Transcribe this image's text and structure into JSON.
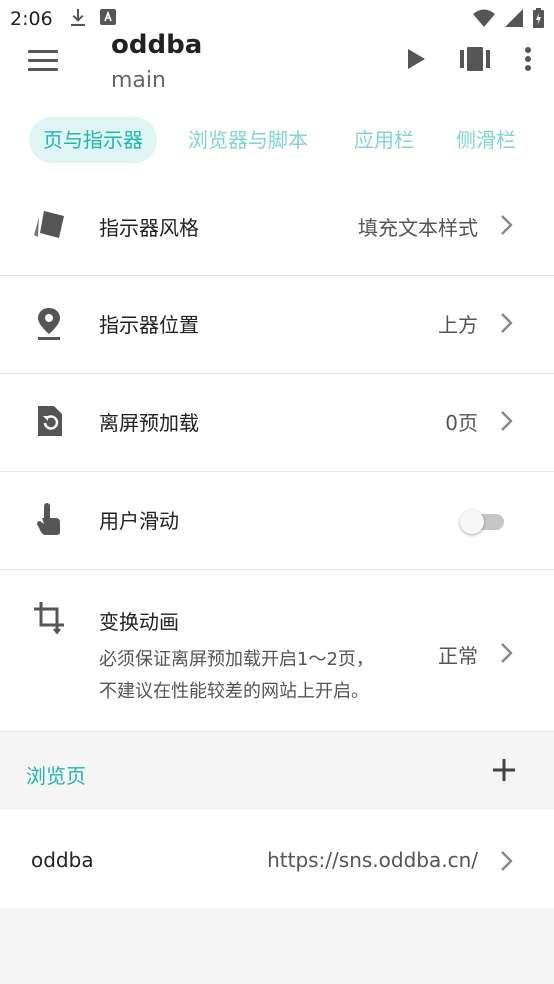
{
  "status": {
    "time": "2:06",
    "icons": [
      "download-icon",
      "a-notification-icon",
      "wifi-icon",
      "signal-icon",
      "battery-icon"
    ]
  },
  "appbar": {
    "title": "oddba",
    "subtitle": "main",
    "actions": [
      "play-icon",
      "view-mode-icon",
      "more-vert-icon"
    ]
  },
  "tabs": [
    {
      "label": "页与指示器",
      "active": true
    },
    {
      "label": "浏览器与脚本",
      "active": false
    },
    {
      "label": "应用栏",
      "active": false
    },
    {
      "label": "侧滑栏",
      "active": false
    }
  ],
  "settings": [
    {
      "label": "指示器风格",
      "value": "填充文本样式",
      "icon": "style-tags-icon"
    },
    {
      "label": "指示器位置",
      "value": "上方",
      "icon": "location-pin-icon"
    },
    {
      "label": "离屏预加载",
      "value": "0页",
      "icon": "preload-refresh-icon"
    },
    {
      "label": "用户滑动",
      "icon": "touch-swipe-icon",
      "toggle_on": false
    },
    {
      "label": "变换动画",
      "desc_line1": "必须保证离屏预加载开启1～2页，",
      "desc_line2": "不建议在性能较差的网站上开启。",
      "value": "正常",
      "icon": "crop-rotate-icon"
    }
  ],
  "pages_section": {
    "title": "浏览页",
    "add_icon": "plus-icon",
    "items": [
      {
        "name": "oddba",
        "url": "https://sns.oddba.cn/"
      }
    ]
  },
  "colors": {
    "accent": "#1fb8ad",
    "accent_light": "#7fd6cf",
    "tab_active_bg": "#dff5f3",
    "icon_gray": "#555555"
  }
}
